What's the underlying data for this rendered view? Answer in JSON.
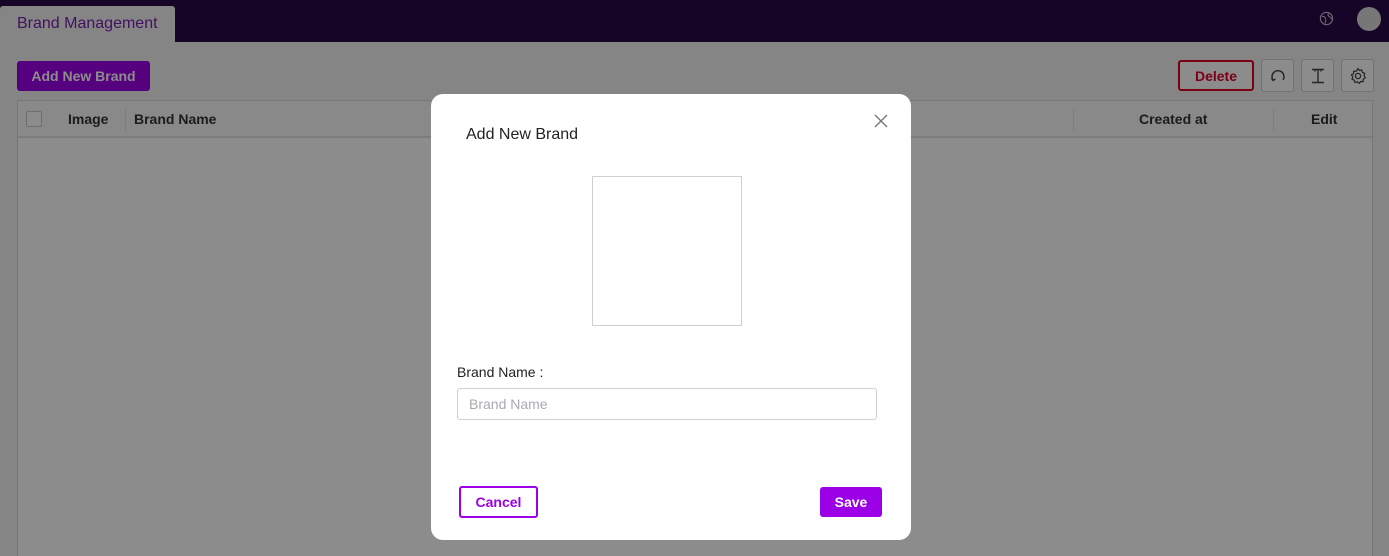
{
  "header": {
    "tab_label": "Brand Management",
    "globe_icon": "globe-icon",
    "avatar_icon": "user-avatar"
  },
  "toolbar": {
    "add_label": "Add New Brand",
    "delete_label": "Delete",
    "icons": [
      "refresh-icon",
      "text-size-icon",
      "gear-icon"
    ]
  },
  "table": {
    "columns": [
      "Image",
      "Brand Name",
      "Created at",
      "Edit"
    ]
  },
  "modal": {
    "title": "Add New Brand",
    "field_label": "Brand Name :",
    "field_placeholder": "Brand Name",
    "field_value": "",
    "cancel_label": "Cancel",
    "save_label": "Save"
  },
  "colors": {
    "topbar": "#2a0a4a",
    "accent": "#9b00e6",
    "danger": "#e0002a"
  }
}
